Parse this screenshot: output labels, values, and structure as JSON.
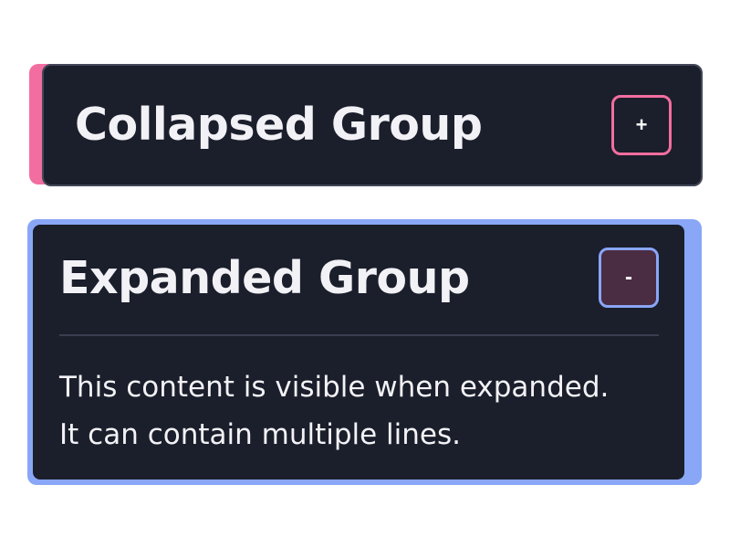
{
  "collapsed_group": {
    "title": "Collapsed Group",
    "toggle_label": "+"
  },
  "expanded_group": {
    "title": "Expanded Group",
    "toggle_label": "-",
    "content": [
      "This content is visible when expanded.",
      "It can contain multiple lines."
    ]
  },
  "colors": {
    "panel_background": "#1b1e2b",
    "collapsed_accent": "#f26ea0",
    "expanded_accent": "#89a6f7",
    "text": "#f2f2f6"
  }
}
